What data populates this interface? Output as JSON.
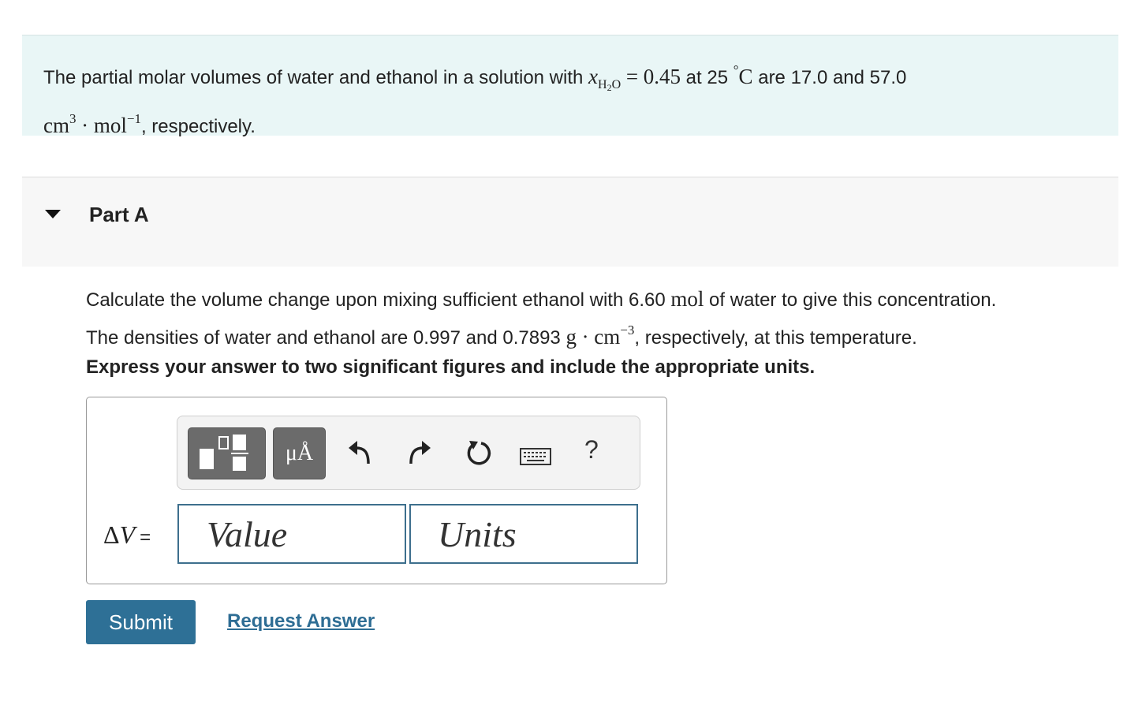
{
  "problem": {
    "intro_prefix": "The partial molar volumes of water and ethanol in a solution with",
    "x_symbol": "x",
    "x_subscript_H": "H",
    "x_subscript_2": "2",
    "x_subscript_O": "O",
    "equals": "=",
    "mole_fraction": "0.45",
    "at": "at 25",
    "degree": "°",
    "celsius": "C",
    "values_text": "are 17.0 and 57.0",
    "unit_cm": "cm",
    "unit_cm_exp": "3",
    "dot": "·",
    "unit_mol": "mol",
    "unit_mol_exp": "−1",
    "suffix": ", respectively."
  },
  "part": {
    "title": "Part A"
  },
  "question": {
    "line1_prefix": "Calculate the volume change upon mixing sufficient ethanol with 6.60",
    "line1_unit": "mol",
    "line1_suffix": "of water to give this concentration.",
    "line2_prefix": "The densities of water and ethanol are 0.997 and 0.7893",
    "line2_unit_g": "g",
    "line2_dot": "·",
    "line2_unit_cm": "cm",
    "line2_exp": "−3",
    "line2_suffix": ", respectively, at this temperature."
  },
  "instruction": "Express your answer to two significant figures and include the appropriate units.",
  "toolbar": {
    "symbols_label": "μÅ",
    "help_label": "?"
  },
  "answer": {
    "delta_symbol": "Δ",
    "variable": "V",
    "equals": "=",
    "value_placeholder": "Value",
    "units_placeholder": "Units"
  },
  "actions": {
    "submit_label": "Submit",
    "request_label": "Request Answer"
  }
}
